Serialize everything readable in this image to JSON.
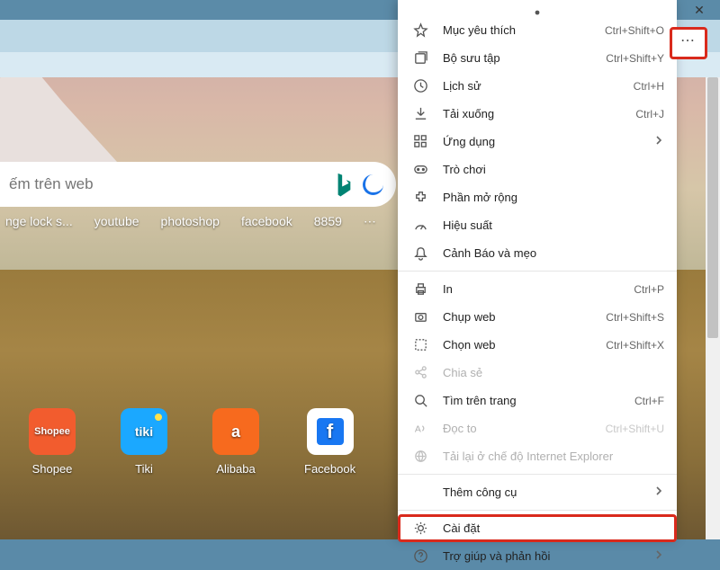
{
  "window": {
    "close_tooltip": "Close"
  },
  "search": {
    "placeholder": "ếm trên web"
  },
  "quicklinks": [
    "nge lock s...",
    "youtube",
    "photoshop",
    "facebook",
    "8859"
  ],
  "tiles": [
    {
      "name": "Shopee",
      "logo_text": "Shopee"
    },
    {
      "name": "Tiki",
      "logo_text": "tiki"
    },
    {
      "name": "Alibaba",
      "logo_text": "a"
    },
    {
      "name": "Facebook",
      "logo_text": "f"
    }
  ],
  "menu": {
    "items": [
      {
        "icon": "star",
        "label": "Mục yêu thích",
        "shortcut": "Ctrl+Shift+O"
      },
      {
        "icon": "collection",
        "label": "Bộ sưu tập",
        "shortcut": "Ctrl+Shift+Y"
      },
      {
        "icon": "history",
        "label": "Lịch sử",
        "shortcut": "Ctrl+H"
      },
      {
        "icon": "download",
        "label": "Tải xuống",
        "shortcut": "Ctrl+J"
      },
      {
        "icon": "apps",
        "label": "Ứng dụng",
        "submenu": true
      },
      {
        "icon": "games",
        "label": "Trò chơi"
      },
      {
        "icon": "extensions",
        "label": "Phần mở rộng"
      },
      {
        "icon": "performance",
        "label": "Hiệu suất"
      },
      {
        "icon": "alerts",
        "label": "Cảnh Báo và mẹo"
      },
      {
        "sep": true
      },
      {
        "icon": "print",
        "label": "In",
        "shortcut": "Ctrl+P"
      },
      {
        "icon": "capture",
        "label": "Chụp web",
        "shortcut": "Ctrl+Shift+S"
      },
      {
        "icon": "select",
        "label": "Chọn web",
        "shortcut": "Ctrl+Shift+X"
      },
      {
        "icon": "share",
        "label": "Chia sẻ",
        "disabled": true
      },
      {
        "icon": "find",
        "label": "Tìm trên trang",
        "shortcut": "Ctrl+F"
      },
      {
        "icon": "read",
        "label": "Đọc to",
        "shortcut": "Ctrl+Shift+U",
        "disabled": true
      },
      {
        "icon": "ie",
        "label": "Tải lại ở chế độ Internet Explorer",
        "disabled": true
      },
      {
        "sep": true
      },
      {
        "indent": true,
        "label": "Thêm công cụ",
        "submenu": true
      },
      {
        "sep": true
      },
      {
        "icon": "settings",
        "label": "Cài đặt",
        "highlight": true
      },
      {
        "icon": "help",
        "label": "Trợ giúp và phản hồi",
        "submenu": true
      }
    ]
  }
}
